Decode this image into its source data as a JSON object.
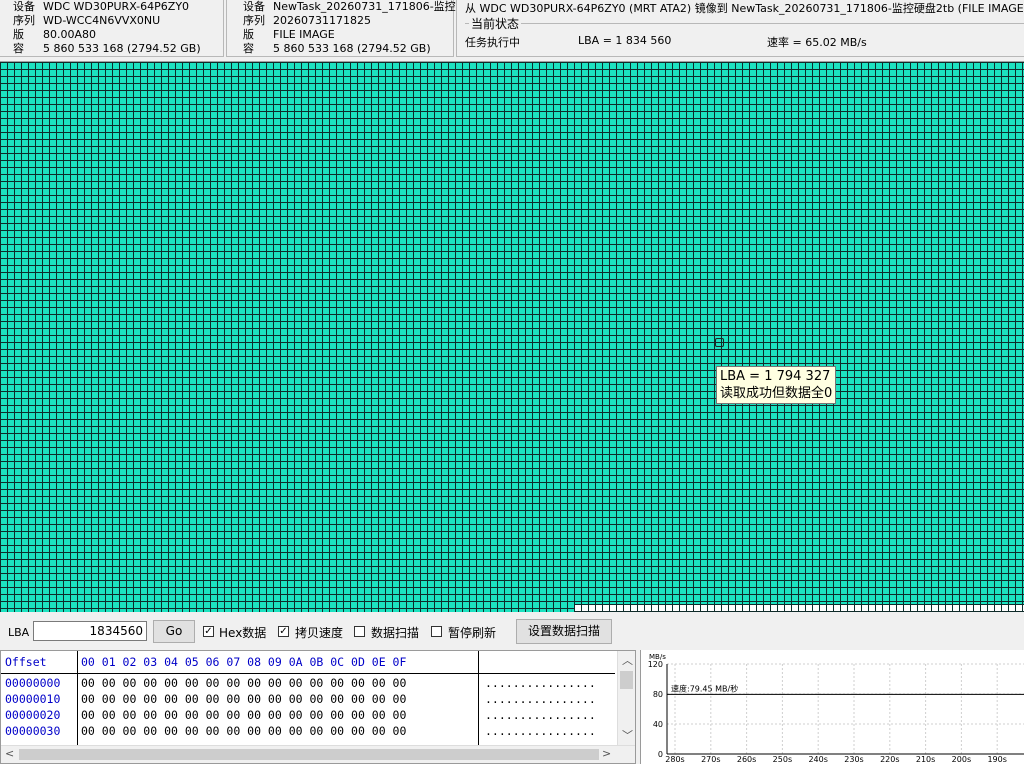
{
  "source": {
    "rows": [
      {
        "label": "设备",
        "value": "WDC WD30PURX-64P6ZY0"
      },
      {
        "label": "序列",
        "value": "WD-WCC4N6VVX0NU"
      },
      {
        "label": "版",
        "value": "80.00A80"
      },
      {
        "label": "容",
        "value": "5 860 533 168 (2794.52 GB)"
      }
    ]
  },
  "target": {
    "rows": [
      {
        "label": "设备",
        "value": "NewTask_20260731_171806-监控"
      },
      {
        "label": "序列",
        "value": "20260731171825"
      },
      {
        "label": "版",
        "value": "FILE IMAGE"
      },
      {
        "label": "容",
        "value": "5 860 533 168 (2794.52 GB)"
      }
    ]
  },
  "task": {
    "route": "从 WDC WD30PURX-64P6ZY0 (MRT ATA2) 镜像到 NewTask_20260731_171806-监控硬盘2tb (FILE IMAGE",
    "status_caption": "当前状态",
    "status_text": "任务执行中",
    "lba_text": "LBA = 1 834 560",
    "speed_text": "速率 = 65.02 MB/s"
  },
  "tooltip": {
    "line1": "LBA = 1 794 327",
    "line2": "读取成功但数据全0"
  },
  "controls": {
    "lba_label": "LBA",
    "lba_value": "1834560",
    "go_label": "Go",
    "hex_label": "Hex数据",
    "hex_checked": true,
    "copy_speed_label": "拷贝速度",
    "copy_speed_checked": true,
    "data_scan_label": "数据扫描",
    "data_scan_checked": false,
    "pause_refresh_label": "暂停刷新",
    "pause_refresh_checked": false,
    "set_scan_label": "设置数据扫描"
  },
  "hex": {
    "header_offset": "Offset",
    "header_bytes": "00 01 02 03 04 05 06 07 08 09 0A 0B 0C 0D 0E 0F",
    "rows": [
      {
        "offset": "00000000",
        "bytes": "00 00 00 00 00 00 00 00 00 00 00 00 00 00 00 00",
        "ascii": "................"
      },
      {
        "offset": "00000010",
        "bytes": "00 00 00 00 00 00 00 00 00 00 00 00 00 00 00 00",
        "ascii": "................"
      },
      {
        "offset": "00000020",
        "bytes": "00 00 00 00 00 00 00 00 00 00 00 00 00 00 00 00",
        "ascii": "................"
      },
      {
        "offset": "00000030",
        "bytes": "00 00 00 00 00 00 00 00 00 00 00 00 00 00 00 00",
        "ascii": "................"
      }
    ]
  },
  "chart_data": {
    "type": "line",
    "ylabel": "MB/s",
    "y_ticks": [
      0,
      40,
      80,
      120
    ],
    "ylim": [
      0,
      120
    ],
    "x_ticks": [
      "280s",
      "270s",
      "260s",
      "250s",
      "240s",
      "230s",
      "220s",
      "210s",
      "200s",
      "190s"
    ],
    "annotation": "速度:79.45 MB/秒",
    "series": [
      {
        "values": [
          79.45,
          79.45,
          79.45,
          79.45,
          79.45,
          79.45,
          79.45,
          79.45,
          79.45,
          79.45
        ]
      }
    ]
  },
  "colors": {
    "block_ok": "#1ce2c0",
    "block_pending": "#ffffff",
    "grid_line": "#0f2b2a",
    "hex_offset": "#0000c8"
  }
}
